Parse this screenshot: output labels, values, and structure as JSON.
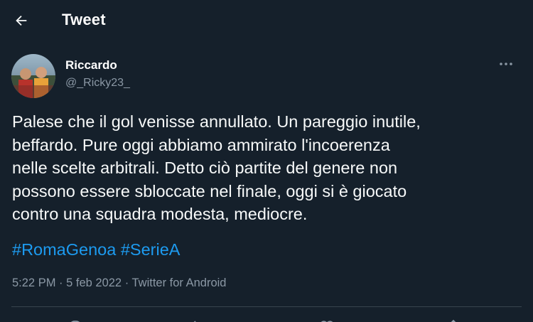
{
  "header": {
    "title": "Tweet",
    "back_icon": "arrow-left-icon"
  },
  "tweet": {
    "author": {
      "display_name": "Riccardo",
      "handle": "@_Ricky23_",
      "avatar": "avatar-photo"
    },
    "more_icon": "more-horizontal-icon",
    "text": "Palese che il gol venisse annullato. Un pareggio inutile,\nbeffardo. Pure oggi abbiamo ammirato l'incoerenza\nnelle scelte arbitrali. Detto ciò partite del genere non\npossono essere sbloccate nel finale, oggi si è giocato\ncontro una squadra modesta, mediocre.",
    "hashtags": [
      "#RomaGenoa",
      "#SerieA"
    ],
    "time": "5:22 PM",
    "separator": " · ",
    "date": "5 feb 2022",
    "source": "Twitter for Android"
  },
  "actions": {
    "icons": [
      "reply-icon",
      "retweet-icon",
      "like-icon",
      "share-icon"
    ]
  },
  "colors": {
    "background": "#15202b",
    "text": "#f7f9f9",
    "secondary": "#8b98a5",
    "accent": "#1d9bf0",
    "divider": "#38444d"
  }
}
